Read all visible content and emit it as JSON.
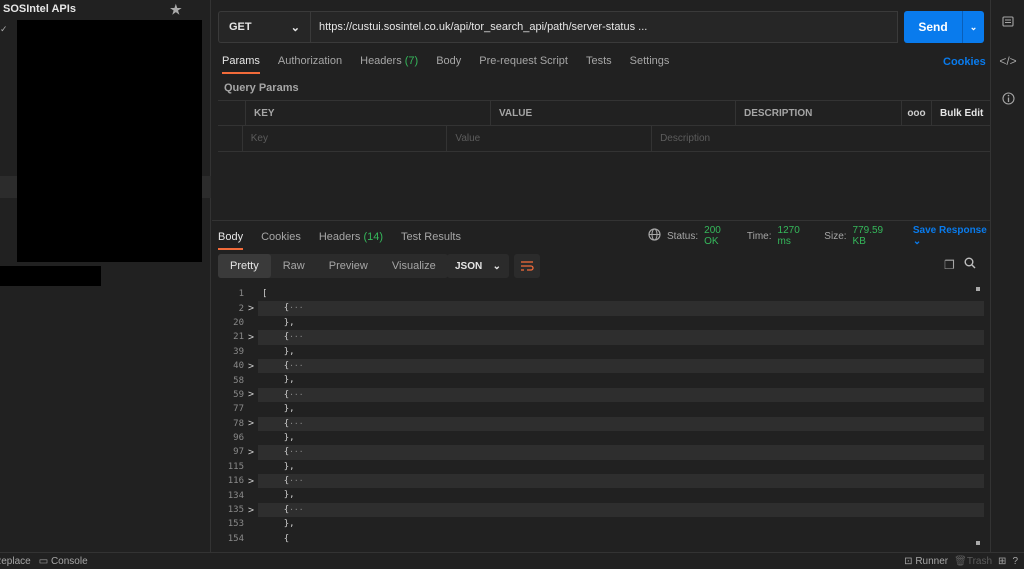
{
  "sidebar": {
    "title": "SOSIntel APIs"
  },
  "request": {
    "method": "GET",
    "url": "https://custui.sosintel.co.uk/api/tor_search_api/path/server-status ...",
    "send_label": "Send"
  },
  "req_tabs": [
    {
      "label": "Params"
    },
    {
      "label": "Authorization"
    },
    {
      "label": "Headers",
      "count": "(7)"
    },
    {
      "label": "Body"
    },
    {
      "label": "Pre-request Script"
    },
    {
      "label": "Tests"
    },
    {
      "label": "Settings"
    }
  ],
  "cookies_label": "Cookies",
  "query_params": {
    "title": "Query Params",
    "headers": {
      "key": "KEY",
      "value": "VALUE",
      "description": "DESCRIPTION",
      "more": "ooo",
      "bulk_edit": "Bulk Edit"
    },
    "placeholders": {
      "key": "Key",
      "value": "Value",
      "description": "Description"
    }
  },
  "response": {
    "tabs": [
      {
        "label": "Body"
      },
      {
        "label": "Cookies"
      },
      {
        "label": "Headers",
        "count": "(14)"
      },
      {
        "label": "Test Results"
      }
    ],
    "status_label": "Status:",
    "status_value": "200 OK",
    "time_label": "Time:",
    "time_value": "1270 ms",
    "size_label": "Size:",
    "size_value": "779.59 KB",
    "save_label": "Save Response",
    "view_tabs": [
      "Pretty",
      "Raw",
      "Preview",
      "Visualize"
    ],
    "format": "JSON"
  },
  "code_lines": [
    {
      "n": "1",
      "arrow": "",
      "text": "[",
      "hl": false
    },
    {
      "n": "2",
      "arrow": ">",
      "text": "{",
      "collapsed": true,
      "hl": true
    },
    {
      "n": "20",
      "arrow": "",
      "text": "},",
      "hl": false
    },
    {
      "n": "21",
      "arrow": ">",
      "text": "{",
      "collapsed": true,
      "hl": true
    },
    {
      "n": "39",
      "arrow": "",
      "text": "},",
      "hl": false
    },
    {
      "n": "40",
      "arrow": ">",
      "text": "{",
      "collapsed": true,
      "hl": true
    },
    {
      "n": "58",
      "arrow": "",
      "text": "},",
      "hl": false
    },
    {
      "n": "59",
      "arrow": ">",
      "text": "{",
      "collapsed": true,
      "hl": true
    },
    {
      "n": "77",
      "arrow": "",
      "text": "},",
      "hl": false
    },
    {
      "n": "78",
      "arrow": ">",
      "text": "{",
      "collapsed": true,
      "hl": true
    },
    {
      "n": "96",
      "arrow": "",
      "text": "},",
      "hl": false
    },
    {
      "n": "97",
      "arrow": ">",
      "text": "{",
      "collapsed": true,
      "hl": true
    },
    {
      "n": "115",
      "arrow": "",
      "text": "},",
      "hl": false
    },
    {
      "n": "116",
      "arrow": ">",
      "text": "{",
      "collapsed": true,
      "hl": true
    },
    {
      "n": "134",
      "arrow": "",
      "text": "},",
      "hl": false
    },
    {
      "n": "135",
      "arrow": ">",
      "text": "{",
      "collapsed": true,
      "hl": true
    },
    {
      "n": "153",
      "arrow": "",
      "text": "},",
      "hl": false
    },
    {
      "n": "154",
      "arrow": "",
      "text": "{",
      "hl": false
    }
  ],
  "statusbar": {
    "replace": "Replace",
    "console": "Console",
    "runner": "Runner",
    "trash": "Trash"
  },
  "colors": {
    "accent": "#097bed",
    "success": "#35b85b",
    "active_tab": "#f26b3a"
  }
}
